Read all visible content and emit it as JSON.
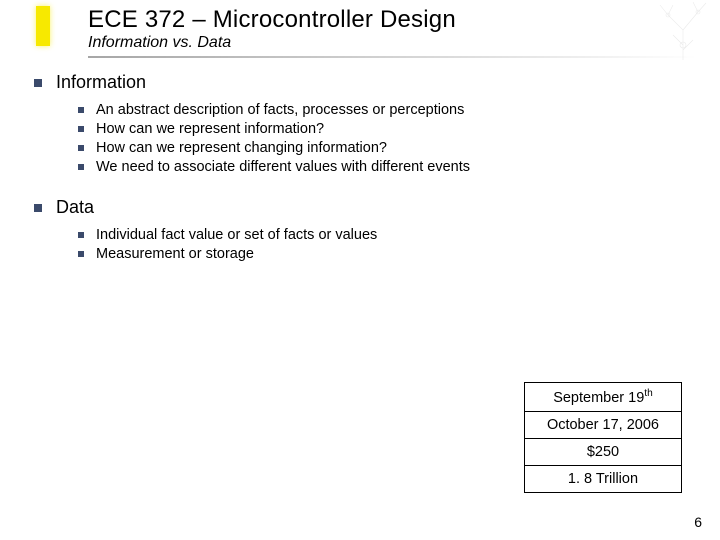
{
  "header": {
    "title": "ECE 372 – Microcontroller Design",
    "subtitle": "Information vs. Data"
  },
  "sections": [
    {
      "heading": "Information",
      "items": [
        "An abstract description of facts, processes or perceptions",
        "How can we represent information?",
        "How can we represent changing information?",
        "We need to associate different values with different events"
      ]
    },
    {
      "heading": "Data",
      "items": [
        "Individual fact value or set of facts or values",
        "Measurement or storage"
      ]
    }
  ],
  "table_rows": {
    "r0_pre": "September 19",
    "r0_sup": "th",
    "r1": "October 17, 2006",
    "r2": "$250",
    "r3": "1. 8 Trillion"
  },
  "page_number": "6"
}
